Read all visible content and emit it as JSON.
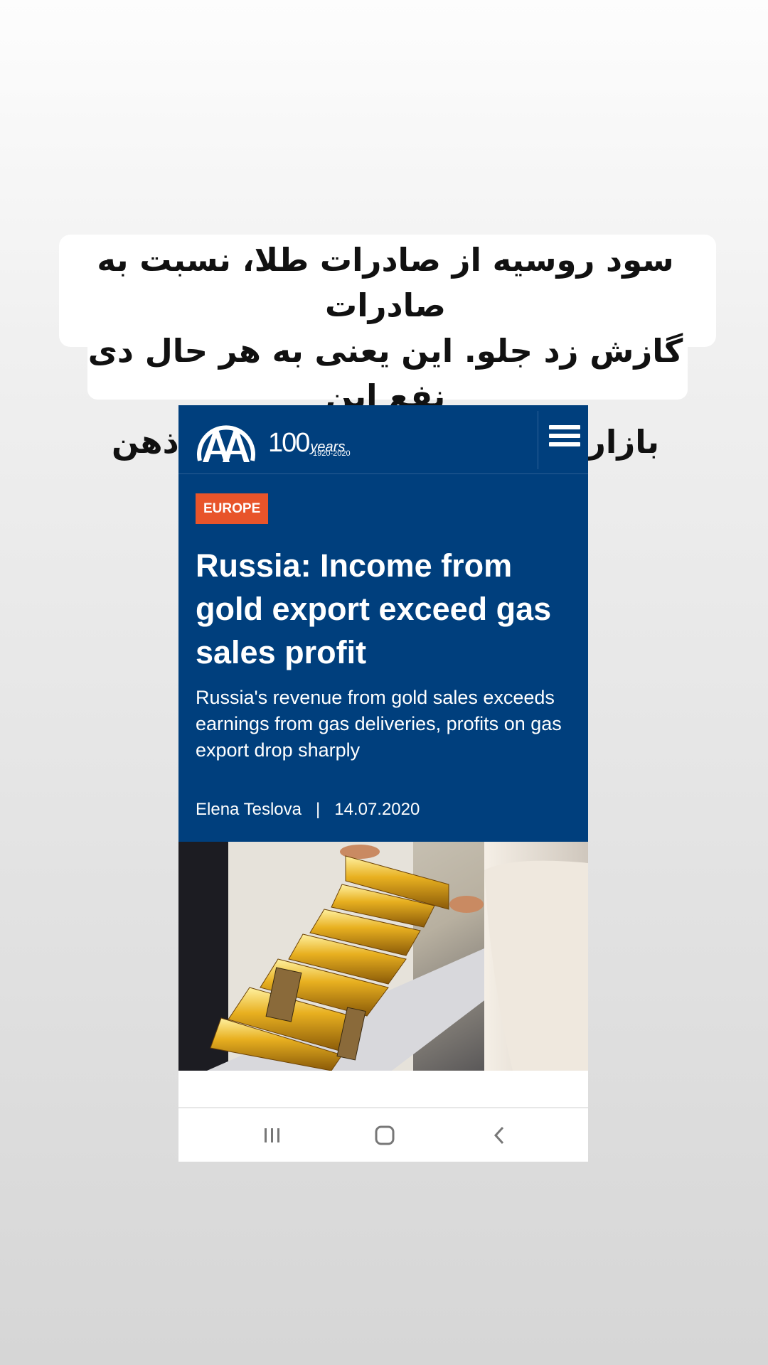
{
  "caption": {
    "lines": [
      "سود روسیه از صادرات طلا، نسبت به صادرات",
      "گازش زد جلو. این یعنی به هر حال دی نفع این",
      "بازاره و انگولک کردنش دور از ذهن نیست"
    ]
  },
  "site": {
    "logo_text": "AA",
    "anniversary_number": "100",
    "anniversary_word": "years",
    "anniversary_span": "1920-2020",
    "menu_icon": "hamburger-menu-icon",
    "brand_color": "#003f7d"
  },
  "article": {
    "category": "EUROPE",
    "category_color": "#e8542a",
    "headline": "Russia: Income from gold export exceed gas sales profit",
    "subtitle": "Russia's revenue from gold sales exceeds earnings from gas deliveries, profits on gas export drop sharply",
    "author": "Elena Teslova",
    "separator": "|",
    "date": "14.07.2020",
    "image_subject": "gold-bars-photo"
  },
  "navbar": {
    "recents_icon": "recent-apps-icon",
    "home_icon": "home-icon",
    "back_icon": "back-icon"
  }
}
